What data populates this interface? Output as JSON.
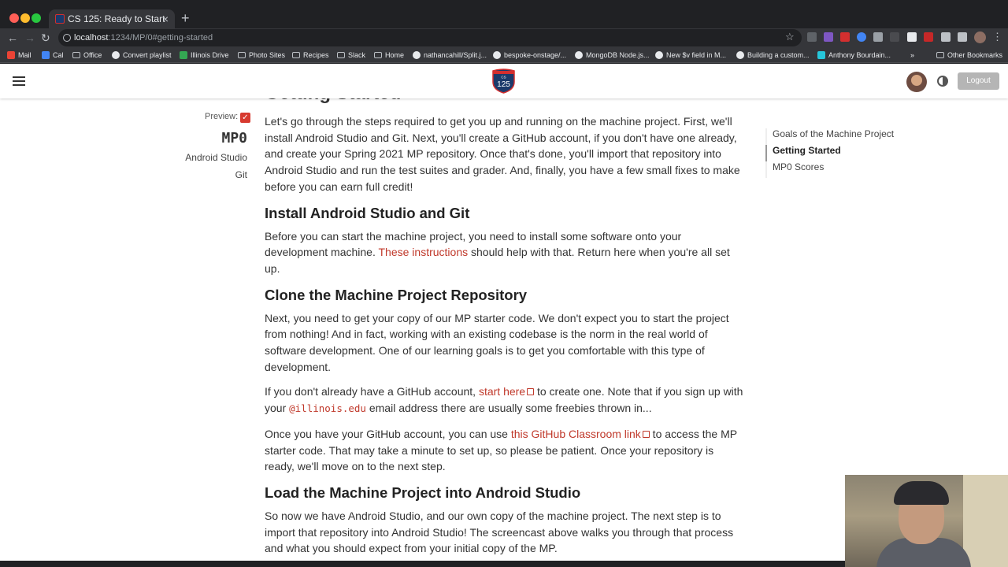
{
  "browser": {
    "tab_title": "CS 125: Ready to Start",
    "tab_close": "×",
    "new_tab": "+",
    "url_host": "localhost",
    "url_path": ":1234/MP/0#getting-started",
    "bookmarks": [
      "Mail",
      "Cal",
      "Office",
      "Convert playlist",
      "Illinois Drive",
      "Photo Sites",
      "Recipes",
      "Slack",
      "Home",
      "nathancahill/Split.j...",
      "bespoke-onstage/...",
      "MongoDB Node.js...",
      "New $v field in M...",
      "Building a custom...",
      "Anthony Bourdain...",
      "»",
      "Other Bookmarks"
    ],
    "colors": {
      "frame": "#202124",
      "toolbar": "#35363a",
      "accent": "#c0392b"
    }
  },
  "header": {
    "logo_text": "125",
    "logo_small": "CS",
    "logout_label": "Logout"
  },
  "cutoff_heading": "Getting Started",
  "sidebar": {
    "preview_label": "Preview:",
    "mp_code": "MP0",
    "tags": [
      "Android Studio",
      "Git"
    ]
  },
  "toc": [
    {
      "label": "Goals of the Machine Project",
      "active": false
    },
    {
      "label": "Getting Started",
      "active": true
    },
    {
      "label": "MP0 Scores",
      "active": false
    }
  ],
  "content": {
    "intro": "Let's go through the steps required to get you up and running on the machine project. First, we'll install Android Studio and Git. Next, you'll create a GitHub account, if you don't have one already, and create your Spring 2021 MP repository. Once that's done, you'll import that repository into Android Studio and run the test suites and grader. And, finally, you have a few small fixes to make before you can earn full credit!",
    "h_install": "Install Android Studio and Git",
    "install_p_before": "Before you can start the machine project, you need to install some software onto your development machine. ",
    "install_link": "These instructions",
    "install_p_after": " should help with that. Return here when you're all set up.",
    "h_clone": "Clone the Machine Project Repository",
    "clone_p1": "Next, you need to get your copy of our MP starter code. We don't expect you to start the project from nothing! And in fact, working with an existing codebase is the norm in the real world of software development. One of our learning goals is to get you comfortable with this type of development.",
    "clone_p2_a": "If you don't already have a GitHub account, ",
    "clone_p2_link": "start here",
    "clone_p2_b": " to create one. Note that if you sign up with your ",
    "clone_p2_code": "@illinois.edu",
    "clone_p2_c": " email address there are usually some freebies thrown in...",
    "clone_p3_a": "Once you have your GitHub account, you can use ",
    "clone_p3_link": "this GitHub Classroom link",
    "clone_p3_b": " to access the MP starter code. That may take a minute to set up, so please be patient. Once your repository is ready, we'll move on to the next step.",
    "h_load": "Load the Machine Project into Android Studio",
    "load_p": "So now we have Android Studio, and our own copy of the machine project. The next step is to import that repository into Android Studio! The screencast above walks you through that process and what you should expect from your initial copy of the MP."
  }
}
